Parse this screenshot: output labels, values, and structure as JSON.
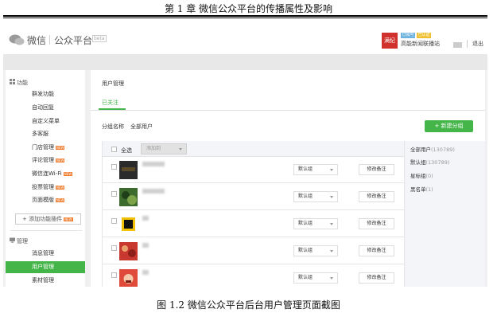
{
  "document": {
    "chapter_header": "第 1 章  微信公众平台的传播属性及影响",
    "figure_caption": "图 1.2  微信公众平台后台用户管理页面截图"
  },
  "topbar": {
    "logo_text": "微信",
    "logo_sub": "公众平台",
    "logo_badge": "beta",
    "account_avatar_text": "满纪",
    "tag_blue": "订阅号",
    "tag_yellow": "已认证",
    "account_name": "高能新闻联播站",
    "logout": "退出"
  },
  "sidebar": {
    "sections": [
      {
        "title": "功能",
        "icon": "grid-icon",
        "items": [
          {
            "label": "群发功能",
            "new": false
          },
          {
            "label": "自动回复",
            "new": false
          },
          {
            "label": "自定义菜单",
            "new": false
          },
          {
            "label": "多客服",
            "new": false
          },
          {
            "label": "门店管理",
            "new": true
          },
          {
            "label": "评论管理",
            "new": true
          },
          {
            "label": "微信连Wi-Fi",
            "new": true
          },
          {
            "label": "投票管理",
            "new": true
          },
          {
            "label": "页面模版",
            "new": true
          }
        ]
      },
      {
        "title": "管理",
        "icon": "monitor-icon",
        "items": [
          {
            "label": "消息管理",
            "new": false
          },
          {
            "label": "用户管理",
            "new": false,
            "active": true
          },
          {
            "label": "素材管理",
            "new": false
          }
        ]
      }
    ],
    "add_plugin": "+ 添加功能插件",
    "new_badge": "NEW"
  },
  "main": {
    "title": "用户管理",
    "tab_active": "已关注",
    "group_label": "分组名称",
    "group_value": "全部用户",
    "new_group_button": "+ 新建分组",
    "select_all": "全选",
    "add_to_placeholder": "添加到",
    "rows": [
      {
        "group": "默认组",
        "remark": "修改备注",
        "avatar": "dark-photo"
      },
      {
        "group": "默认组",
        "remark": "修改备注",
        "avatar": "green-photo"
      },
      {
        "group": "默认组",
        "remark": "修改备注",
        "avatar": "tiger-character"
      },
      {
        "group": "默认组",
        "remark": "修改备注",
        "avatar": "food-photo"
      },
      {
        "group": "默认组",
        "remark": "修改备注",
        "avatar": "red-face"
      }
    ],
    "groups": [
      {
        "name": "全部用户",
        "count": "(130789)"
      },
      {
        "name": "默认组",
        "count": "(130789)"
      },
      {
        "name": "星标组",
        "count": "(0)"
      },
      {
        "name": "黑名单",
        "count": "(1)"
      }
    ]
  },
  "colors": {
    "accent_green": "#44b549",
    "new_badge_orange": "#f27a2c",
    "brand_red": "#d0312d"
  }
}
